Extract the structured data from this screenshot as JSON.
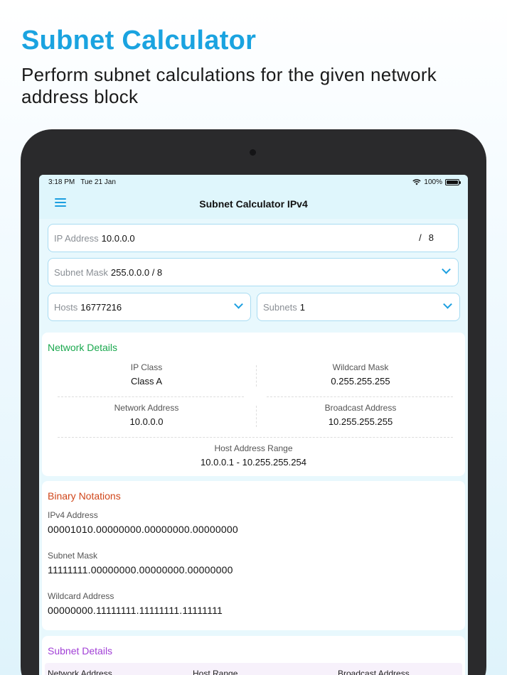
{
  "promo": {
    "title": "Subnet Calculator",
    "subtitle": "Perform subnet calculations for the given network address block"
  },
  "status_bar": {
    "time": "3:18 PM",
    "date": "Tue 21 Jan",
    "battery": "100%",
    "icons": [
      "wifi-icon",
      "battery-icon"
    ]
  },
  "nav": {
    "title": "Subnet Calculator IPv4",
    "menu_icon": "hamburger-menu-icon"
  },
  "inputs": {
    "ip_address": {
      "label": "IP Address",
      "value": "10.0.0.0",
      "slash": "/",
      "prefix": "8"
    },
    "subnet_mask": {
      "label": "Subnet Mask",
      "value": "255.0.0.0 / 8"
    },
    "hosts": {
      "label": "Hosts",
      "value": "16777216"
    },
    "subnets": {
      "label": "Subnets",
      "value": "1"
    }
  },
  "network_details": {
    "title": "Network Details",
    "title_color": "#1aa84e",
    "ip_class": {
      "label": "IP Class",
      "value": "Class A"
    },
    "wildcard_mask": {
      "label": "Wildcard Mask",
      "value": "0.255.255.255"
    },
    "network_address": {
      "label": "Network Address",
      "value": "10.0.0.0"
    },
    "broadcast_address": {
      "label": "Broadcast Address",
      "value": "10.255.255.255"
    },
    "host_range": {
      "label": "Host Address Range",
      "value": "10.0.0.1 - 10.255.255.254"
    }
  },
  "binary_notations": {
    "title": "Binary Notations",
    "title_color": "#d0461a",
    "ipv4": {
      "label": "IPv4 Address",
      "value": "00001010.00000000.00000000.00000000"
    },
    "subnet_mask": {
      "label": "Subnet Mask",
      "value": "11111111.00000000.00000000.00000000"
    },
    "wildcard": {
      "label": "Wildcard Address",
      "value": "00000000.11111111.11111111.11111111"
    }
  },
  "subnet_details": {
    "title": "Subnet Details",
    "title_color": "#a13fd6",
    "columns": [
      "Network Address",
      "Host Range",
      "Broadcast Address"
    ]
  },
  "colors": {
    "accent": "#1aa3e0",
    "field_border": "#a9dcf2",
    "device": "#2a2a2c"
  }
}
